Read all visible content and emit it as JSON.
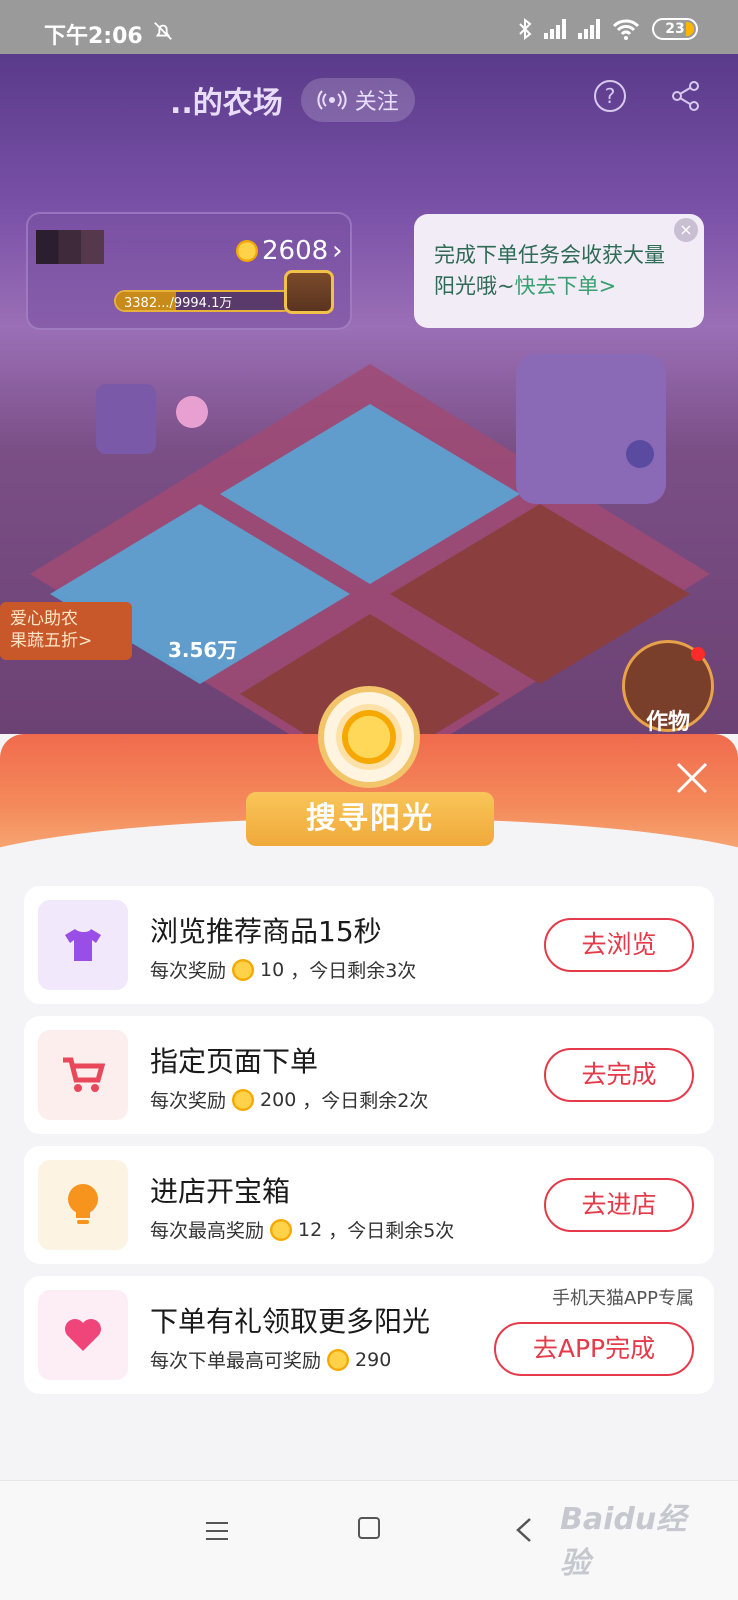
{
  "status_bar": {
    "time": "下午2:06",
    "battery": "23"
  },
  "farm": {
    "title": "..的农场",
    "follow_label": "关注",
    "sun_count": "2608",
    "progress_text": "3382.../9994.1万",
    "progress_fraction": 0.34,
    "bubble_text": "完成下单任务会收获大量阳光哦~",
    "bubble_link": "快去下单>",
    "left_badge_line1": "爱心助农",
    "left_badge_line2": "果蔬五折>",
    "floating_number": "3.56万",
    "crops_label": "作物"
  },
  "sheet": {
    "title": "搜寻阳光",
    "tasks": [
      {
        "title": "浏览推荐商品15秒",
        "reward_prefix": "每次奖励",
        "reward_value": "10",
        "reward_suffix": "，今日剩余3次",
        "button": "去浏览",
        "icon": "tshirt-icon",
        "icon_bg": "#f1e8fc"
      },
      {
        "title": "指定页面下单",
        "reward_prefix": "每次奖励",
        "reward_value": "200",
        "reward_suffix": "，今日剩余2次",
        "button": "去完成",
        "icon": "cart-icon",
        "icon_bg": "#fdeeee"
      },
      {
        "title": "进店开宝箱",
        "reward_prefix": "每次最高奖励",
        "reward_value": "12",
        "reward_suffix": "，今日剩余5次",
        "button": "去进店",
        "icon": "lightbulb-icon",
        "icon_bg": "#fdf3e2"
      },
      {
        "title": "下单有礼领取更多阳光",
        "reward_prefix": "每次下单最高可奖励",
        "reward_value": "290",
        "reward_suffix": "",
        "button": "去APP完成",
        "note": "手机天猫APP专属",
        "icon": "heart-icon",
        "icon_bg": "#fdeef6"
      }
    ]
  },
  "colors": {
    "accent": "#e43a4a",
    "sun": "#f6a800",
    "header": "#f06b4d"
  },
  "watermark": "Baidu经验"
}
